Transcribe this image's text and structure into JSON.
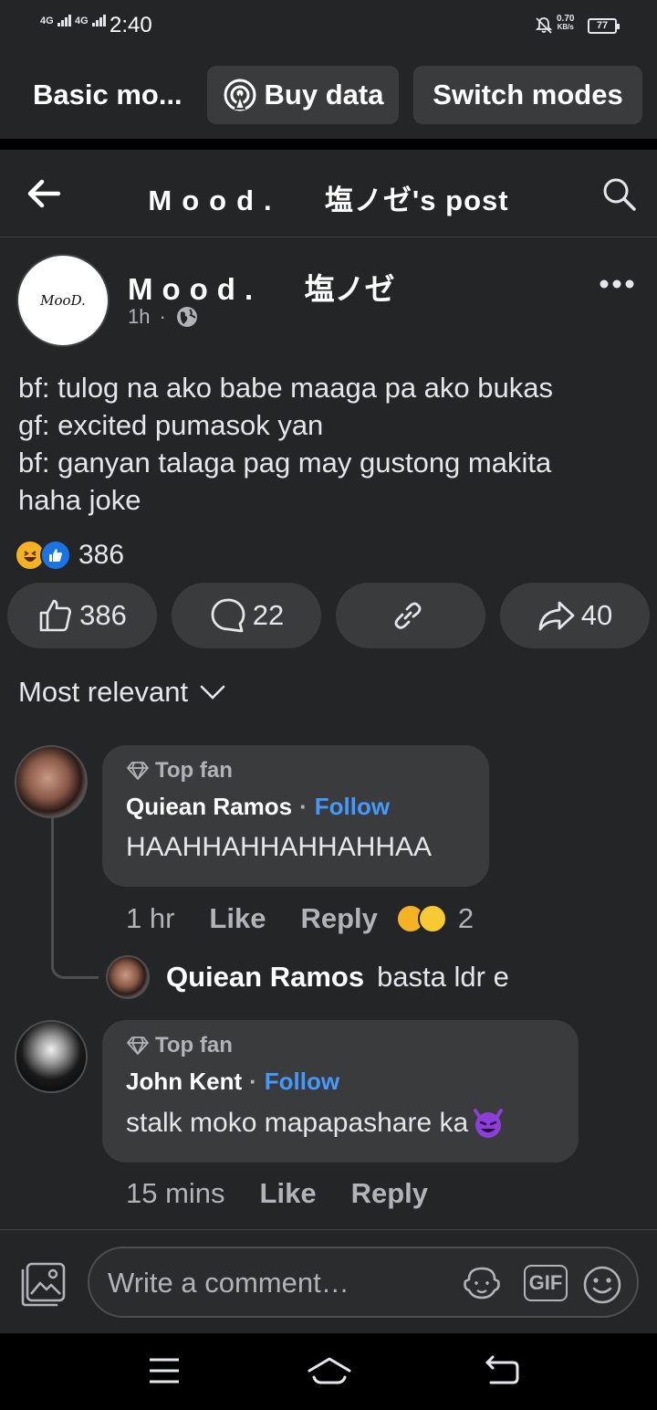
{
  "status_bar": {
    "signal1": "4G",
    "signal2": "4G",
    "time": "2:40",
    "net_speed_value": "0.70",
    "net_speed_unit": "KB/s",
    "battery": "77"
  },
  "mode_bar": {
    "title": "Basic mo...",
    "buy_data_label": "Buy data",
    "switch_modes_label": "Switch modes"
  },
  "header": {
    "page_name": "Mood.",
    "page_suffix": "塩ノゼ's post"
  },
  "post": {
    "avatar_text": "MooD.",
    "author_name": "Mood.",
    "author_suffix": "塩ノゼ",
    "time": "1h",
    "lines": [
      "bf: tulog na ako babe maaga pa ako bukas",
      "gf: excited pumasok yan",
      "bf: ganyan talaga pag may gustong makita",
      "haha joke"
    ],
    "reaction_count": "386",
    "actions": {
      "likes": "386",
      "comments": "22",
      "shares": "40"
    }
  },
  "comments_sort": "Most relevant",
  "comments": [
    {
      "badge": "Top fan",
      "name": "Quiean Ramos",
      "follow": "Follow",
      "text": "HAAHHAHHAHHAHHAA",
      "time": "1 hr",
      "like": "Like",
      "reply": "Reply",
      "reaction_count": "2",
      "reply_preview": {
        "name": "Quiean Ramos",
        "text": "basta ldr e"
      }
    },
    {
      "badge": "Top fan",
      "name": "John Kent",
      "follow": "Follow",
      "text": "stalk moko mapapashare ka",
      "time": "15 mins",
      "like": "Like",
      "reply": "Reply"
    }
  ],
  "composer": {
    "placeholder": "Write a comment…",
    "gif_label": "GIF"
  },
  "colors": {
    "background": "#242526",
    "pill": "#3a3b3c",
    "link_blue": "#4599ff",
    "like_blue": "#1b74e4",
    "haha_yellow": "#f7b125"
  }
}
